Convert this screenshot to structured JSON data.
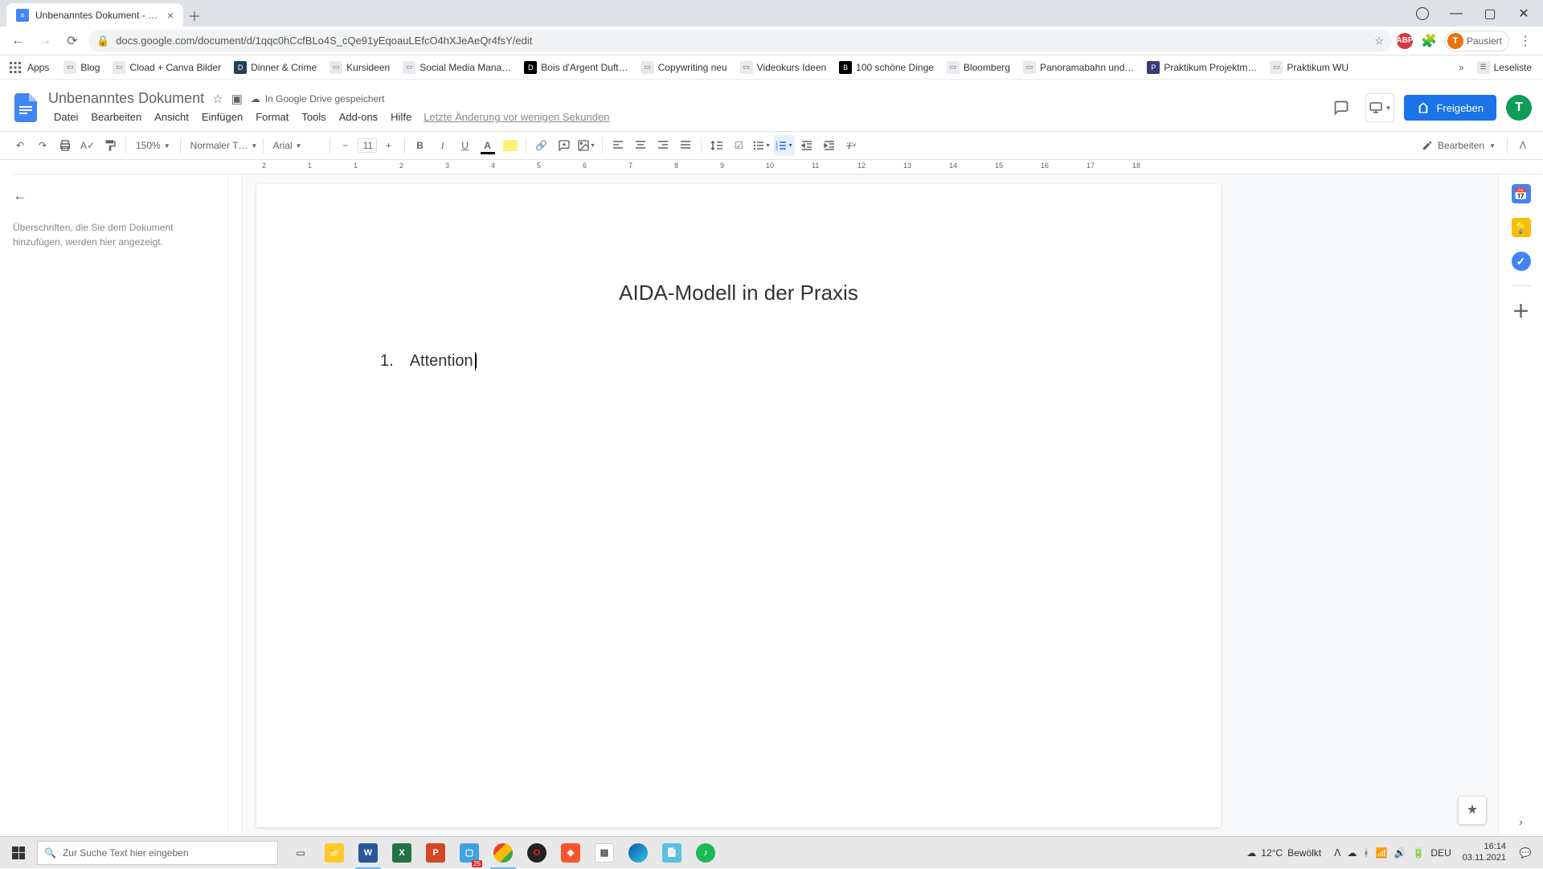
{
  "browser": {
    "tab_title": "Unbenanntes Dokument - Googl",
    "url": "docs.google.com/document/d/1qqc0hCcfBLo4S_cQe91yEqoauLEfcO4hXJeAeQr4fsY/edit",
    "profile_status": "Pausiert",
    "profile_initial": "T"
  },
  "bookmarks": {
    "apps": "Apps",
    "items": [
      "Blog",
      "Cload + Canva Bilder",
      "Dinner & Crime",
      "Kursideen",
      "Social Media Mana…",
      "Bois d'Argent Duft…",
      "Copywriting neu",
      "Videokurs Ideen",
      "100 schöne Dinge",
      "Bloomberg",
      "Panoramabahn und…",
      "Praktikum Projektm…",
      "Praktikum WU"
    ],
    "overflow": "»",
    "reading_list": "Leseliste"
  },
  "docs": {
    "title": "Unbenanntes Dokument",
    "save_status": "In Google Drive gespeichert",
    "menus": [
      "Datei",
      "Bearbeiten",
      "Ansicht",
      "Einfügen",
      "Format",
      "Tools",
      "Add-ons",
      "Hilfe"
    ],
    "last_edit": "Letzte Änderung vor wenigen Sekunden",
    "share": "Freigeben",
    "avatar_initial": "T",
    "zoom": "150%",
    "style": "Normaler T…",
    "font": "Arial",
    "font_size": "11",
    "edit_mode": "Bearbeiten",
    "outline_placeholder": "Überschriften, die Sie dem Dokument hinzufügen, werden hier angezeigt.",
    "ruler_numbers": [
      "2",
      "1",
      "1",
      "2",
      "3",
      "4",
      "5",
      "6",
      "7",
      "8",
      "9",
      "10",
      "11",
      "12",
      "13",
      "14",
      "15",
      "16",
      "17",
      "18"
    ]
  },
  "document": {
    "heading": "AIDA-Modell in der Praxis",
    "list_number": "1.",
    "list_text": "Attention"
  },
  "taskbar": {
    "search_placeholder": "Zur Suche Text hier eingeben",
    "weather_temp": "12°C",
    "weather_condition": "Bewölkt",
    "ime": "DEU",
    "time": "16:14",
    "date": "03.11.2021",
    "explorer_badge": "25"
  }
}
